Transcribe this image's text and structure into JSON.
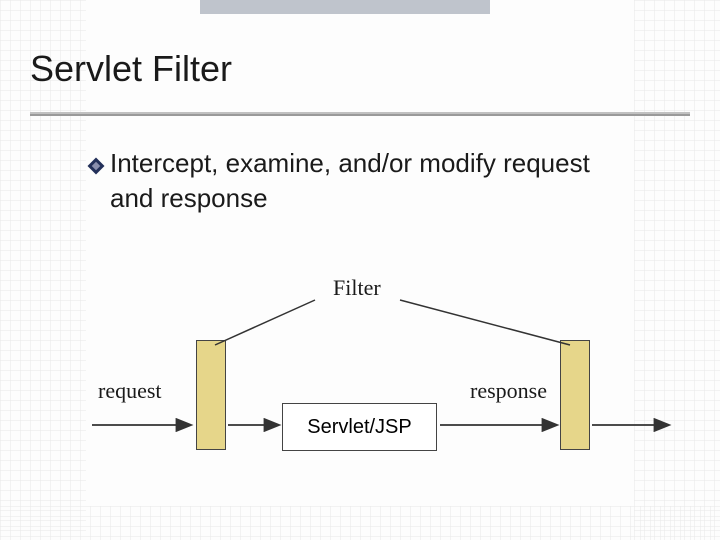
{
  "title": "Servlet Filter",
  "bullet": "Intercept, examine, and/or modify request and response",
  "diagram": {
    "filter_label": "Filter",
    "request_label": "request",
    "response_label": "response",
    "servlet_box": "Servlet/JSP"
  },
  "colors": {
    "bar_fill": "#e6d68a",
    "accent": "#23305a",
    "topbar": "#bfc4cc"
  }
}
